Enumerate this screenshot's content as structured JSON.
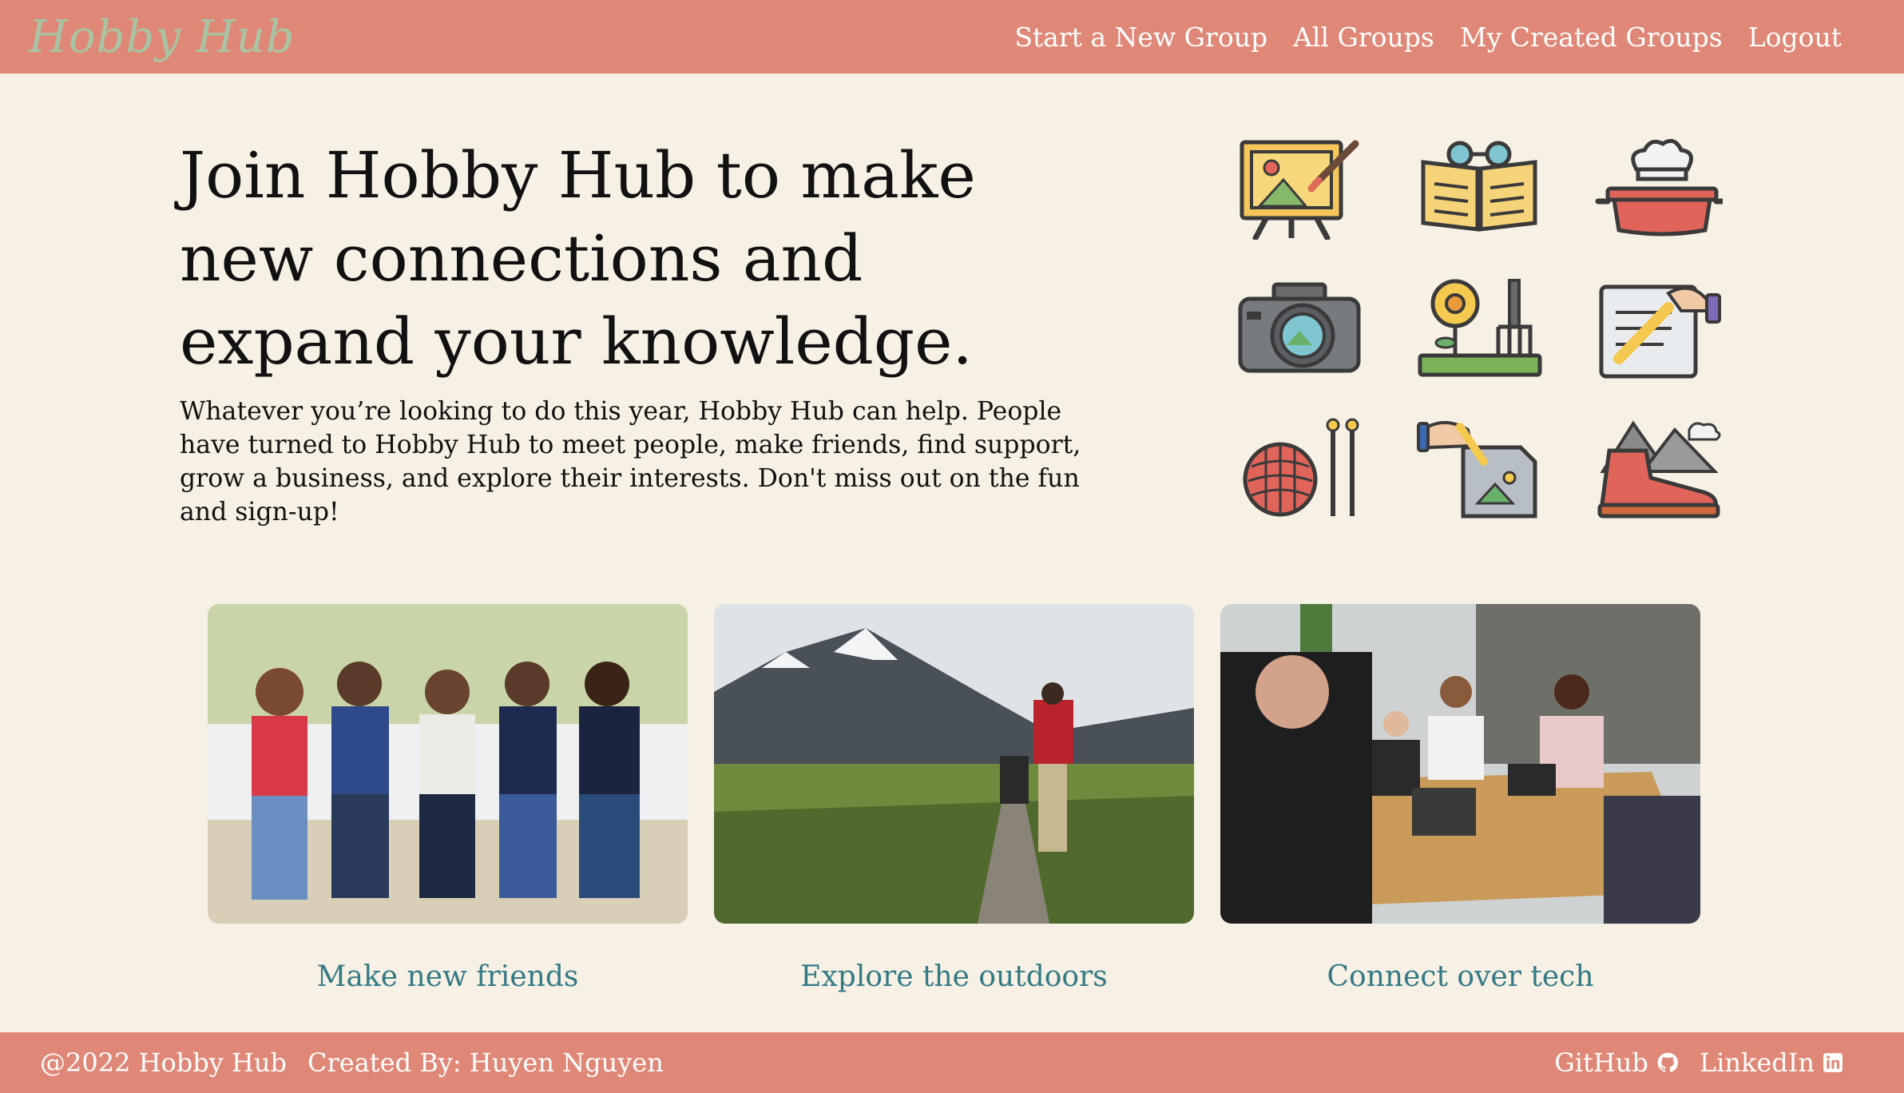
{
  "nav": {
    "logo": "Hobby Hub",
    "links": [
      "Start a New Group",
      "All Groups",
      "My Created Groups",
      "Logout"
    ]
  },
  "hero": {
    "heading": "Join Hobby Hub to make new connections and expand your knowledge.",
    "text": "Whatever you’re looking to do this year, Hobby Hub can help. People have turned to Hobby Hub to meet people, make friends, find support, grow a business, and explore their interests. Don't miss out on the fun and sign-up!"
  },
  "hobby_icons": [
    "painting-easel-icon",
    "reading-book-icon",
    "cooking-pot-icon",
    "camera-icon",
    "gardening-icon",
    "writing-icon",
    "knitting-icon",
    "drawing-icon",
    "hiking-boot-icon"
  ],
  "cards": [
    {
      "caption": "Make new friends",
      "image": "group-of-friends-photo"
    },
    {
      "caption": "Explore the outdoors",
      "image": "mountain-hikers-photo"
    },
    {
      "caption": "Connect over tech",
      "image": "tech-meeting-photo"
    }
  ],
  "footer": {
    "copyright": "@2022 Hobby Hub",
    "credit": "Created By: Huyen Nguyen",
    "github": "GitHub",
    "linkedin": "LinkedIn"
  },
  "colors": {
    "nav_bg": "#e08878",
    "page_bg": "#f7f0e4",
    "logo": "#a9c4a4",
    "caption": "#337a86"
  }
}
